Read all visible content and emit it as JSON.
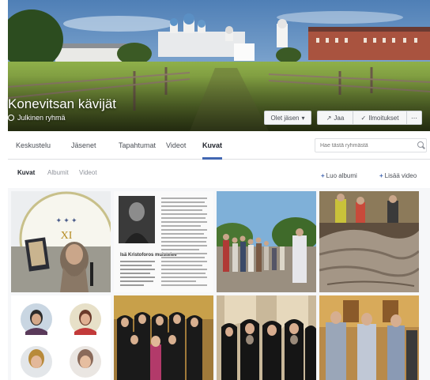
{
  "cover": {
    "group_title": "Konevitsan kävijät",
    "privacy_label": "Julkinen ryhmä",
    "member_button": "Olet jäsen",
    "share_button": "Jaa",
    "notify_button": "Ilmoitukset"
  },
  "tabs": [
    {
      "label": "Keskustelu"
    },
    {
      "label": "Jäsenet"
    },
    {
      "label": "Tapahtumat"
    },
    {
      "label": "Videot"
    },
    {
      "label": "Kuvat"
    }
  ],
  "search": {
    "placeholder": "Hae tästä ryhmästä"
  },
  "photos": {
    "subtabs": [
      {
        "label": "Kuvat"
      },
      {
        "label": "Albumit"
      },
      {
        "label": "Videot"
      }
    ],
    "add_album": "Luo albumi",
    "add_video": "Lisää video",
    "tile1_text": "XI",
    "tile2_caption": "Isä Kristoforos muistelee"
  },
  "colors": {
    "accent": "#4267b2",
    "panel_bg": "#f6f7f9"
  }
}
